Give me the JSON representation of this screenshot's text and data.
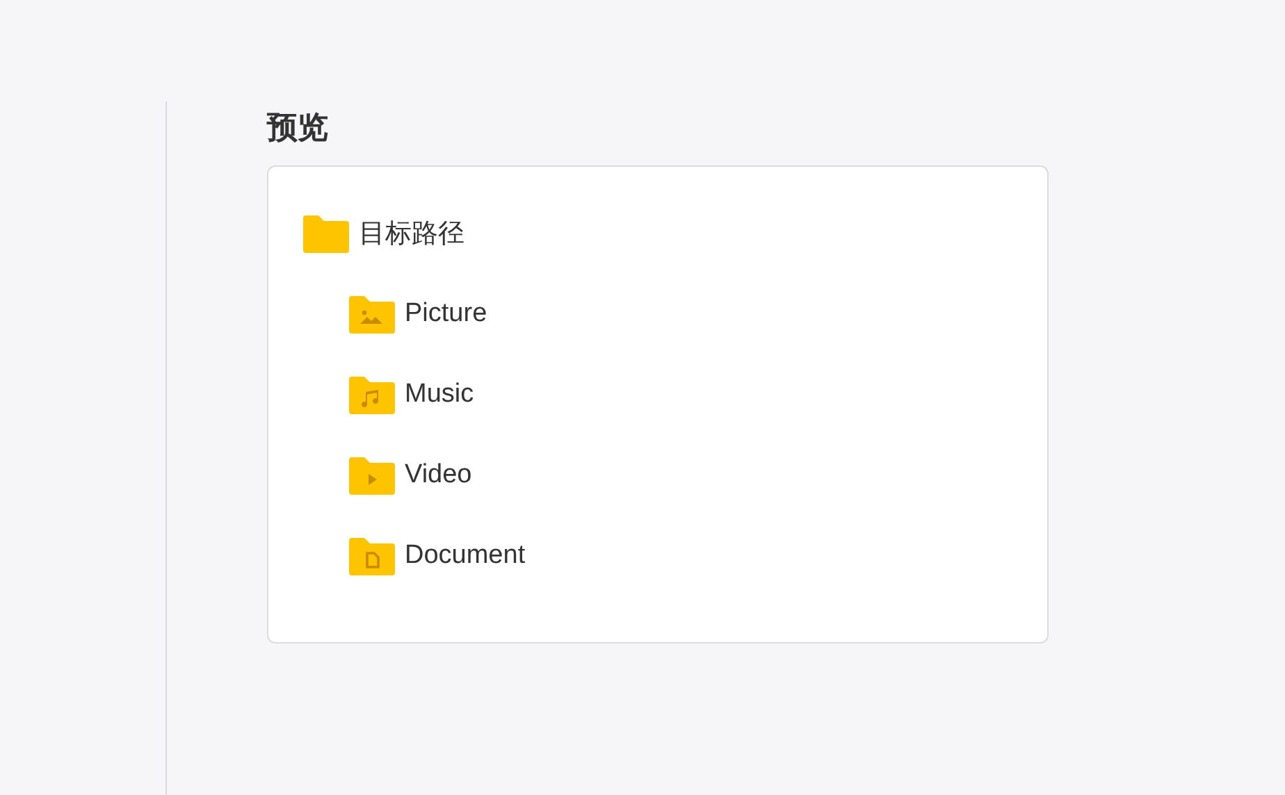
{
  "section_title": "预览",
  "tree": {
    "label": "目标路径",
    "children": [
      {
        "label": "Picture",
        "kind": "picture"
      },
      {
        "label": "Music",
        "kind": "music"
      },
      {
        "label": "Video",
        "kind": "video"
      },
      {
        "label": "Document",
        "kind": "document"
      }
    ]
  }
}
